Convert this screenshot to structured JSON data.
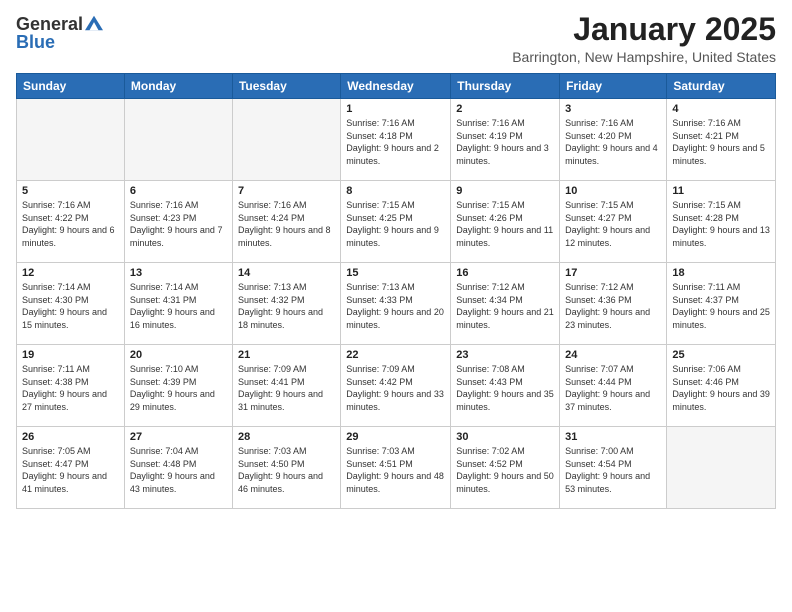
{
  "header": {
    "logo_general": "General",
    "logo_blue": "Blue",
    "month": "January 2025",
    "location": "Barrington, New Hampshire, United States"
  },
  "days_of_week": [
    "Sunday",
    "Monday",
    "Tuesday",
    "Wednesday",
    "Thursday",
    "Friday",
    "Saturday"
  ],
  "weeks": [
    [
      {
        "day": "",
        "info": ""
      },
      {
        "day": "",
        "info": ""
      },
      {
        "day": "",
        "info": ""
      },
      {
        "day": "1",
        "info": "Sunrise: 7:16 AM\nSunset: 4:18 PM\nDaylight: 9 hours and 2 minutes."
      },
      {
        "day": "2",
        "info": "Sunrise: 7:16 AM\nSunset: 4:19 PM\nDaylight: 9 hours and 3 minutes."
      },
      {
        "day": "3",
        "info": "Sunrise: 7:16 AM\nSunset: 4:20 PM\nDaylight: 9 hours and 4 minutes."
      },
      {
        "day": "4",
        "info": "Sunrise: 7:16 AM\nSunset: 4:21 PM\nDaylight: 9 hours and 5 minutes."
      }
    ],
    [
      {
        "day": "5",
        "info": "Sunrise: 7:16 AM\nSunset: 4:22 PM\nDaylight: 9 hours and 6 minutes."
      },
      {
        "day": "6",
        "info": "Sunrise: 7:16 AM\nSunset: 4:23 PM\nDaylight: 9 hours and 7 minutes."
      },
      {
        "day": "7",
        "info": "Sunrise: 7:16 AM\nSunset: 4:24 PM\nDaylight: 9 hours and 8 minutes."
      },
      {
        "day": "8",
        "info": "Sunrise: 7:15 AM\nSunset: 4:25 PM\nDaylight: 9 hours and 9 minutes."
      },
      {
        "day": "9",
        "info": "Sunrise: 7:15 AM\nSunset: 4:26 PM\nDaylight: 9 hours and 11 minutes."
      },
      {
        "day": "10",
        "info": "Sunrise: 7:15 AM\nSunset: 4:27 PM\nDaylight: 9 hours and 12 minutes."
      },
      {
        "day": "11",
        "info": "Sunrise: 7:15 AM\nSunset: 4:28 PM\nDaylight: 9 hours and 13 minutes."
      }
    ],
    [
      {
        "day": "12",
        "info": "Sunrise: 7:14 AM\nSunset: 4:30 PM\nDaylight: 9 hours and 15 minutes."
      },
      {
        "day": "13",
        "info": "Sunrise: 7:14 AM\nSunset: 4:31 PM\nDaylight: 9 hours and 16 minutes."
      },
      {
        "day": "14",
        "info": "Sunrise: 7:13 AM\nSunset: 4:32 PM\nDaylight: 9 hours and 18 minutes."
      },
      {
        "day": "15",
        "info": "Sunrise: 7:13 AM\nSunset: 4:33 PM\nDaylight: 9 hours and 20 minutes."
      },
      {
        "day": "16",
        "info": "Sunrise: 7:12 AM\nSunset: 4:34 PM\nDaylight: 9 hours and 21 minutes."
      },
      {
        "day": "17",
        "info": "Sunrise: 7:12 AM\nSunset: 4:36 PM\nDaylight: 9 hours and 23 minutes."
      },
      {
        "day": "18",
        "info": "Sunrise: 7:11 AM\nSunset: 4:37 PM\nDaylight: 9 hours and 25 minutes."
      }
    ],
    [
      {
        "day": "19",
        "info": "Sunrise: 7:11 AM\nSunset: 4:38 PM\nDaylight: 9 hours and 27 minutes."
      },
      {
        "day": "20",
        "info": "Sunrise: 7:10 AM\nSunset: 4:39 PM\nDaylight: 9 hours and 29 minutes."
      },
      {
        "day": "21",
        "info": "Sunrise: 7:09 AM\nSunset: 4:41 PM\nDaylight: 9 hours and 31 minutes."
      },
      {
        "day": "22",
        "info": "Sunrise: 7:09 AM\nSunset: 4:42 PM\nDaylight: 9 hours and 33 minutes."
      },
      {
        "day": "23",
        "info": "Sunrise: 7:08 AM\nSunset: 4:43 PM\nDaylight: 9 hours and 35 minutes."
      },
      {
        "day": "24",
        "info": "Sunrise: 7:07 AM\nSunset: 4:44 PM\nDaylight: 9 hours and 37 minutes."
      },
      {
        "day": "25",
        "info": "Sunrise: 7:06 AM\nSunset: 4:46 PM\nDaylight: 9 hours and 39 minutes."
      }
    ],
    [
      {
        "day": "26",
        "info": "Sunrise: 7:05 AM\nSunset: 4:47 PM\nDaylight: 9 hours and 41 minutes."
      },
      {
        "day": "27",
        "info": "Sunrise: 7:04 AM\nSunset: 4:48 PM\nDaylight: 9 hours and 43 minutes."
      },
      {
        "day": "28",
        "info": "Sunrise: 7:03 AM\nSunset: 4:50 PM\nDaylight: 9 hours and 46 minutes."
      },
      {
        "day": "29",
        "info": "Sunrise: 7:03 AM\nSunset: 4:51 PM\nDaylight: 9 hours and 48 minutes."
      },
      {
        "day": "30",
        "info": "Sunrise: 7:02 AM\nSunset: 4:52 PM\nDaylight: 9 hours and 50 minutes."
      },
      {
        "day": "31",
        "info": "Sunrise: 7:00 AM\nSunset: 4:54 PM\nDaylight: 9 hours and 53 minutes."
      },
      {
        "day": "",
        "info": ""
      }
    ]
  ]
}
